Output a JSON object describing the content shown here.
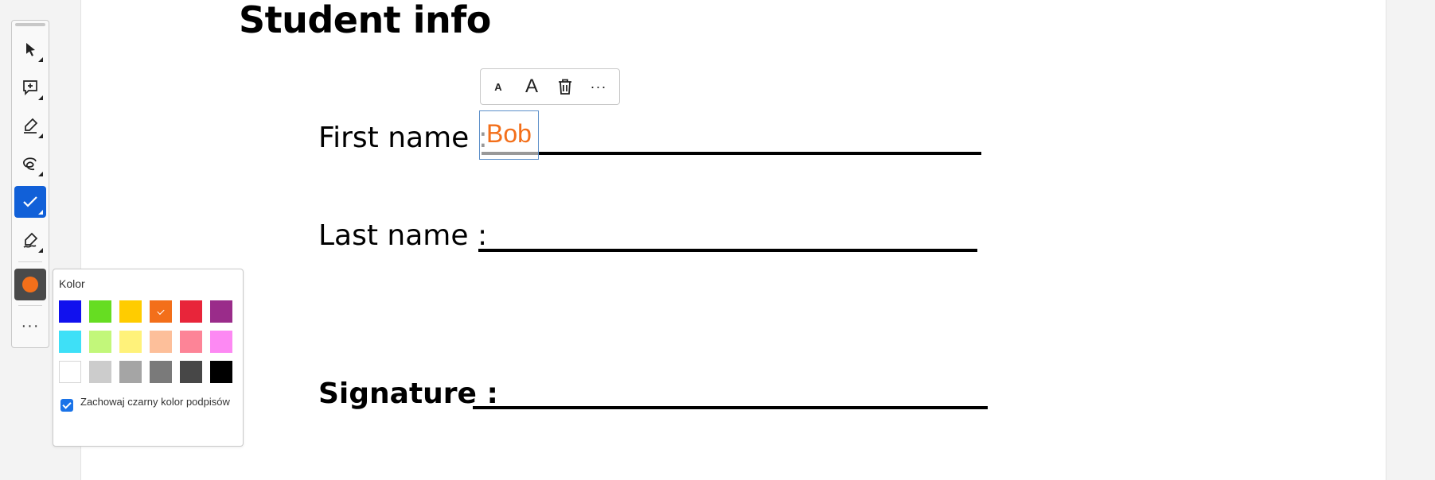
{
  "document": {
    "title": "Student info",
    "fields": [
      {
        "label": "First name :"
      },
      {
        "label": "Last name :"
      },
      {
        "label": "Signature :"
      }
    ]
  },
  "annotation": {
    "text": "Bob",
    "color": "#f36f1a"
  },
  "toolbar": {
    "tools": [
      {
        "name": "select",
        "icon": "cursor-arrow-icon"
      },
      {
        "name": "comment",
        "icon": "comment-add-icon"
      },
      {
        "name": "highlight",
        "icon": "highlighter-icon"
      },
      {
        "name": "freehand",
        "icon": "freehand-loop-icon"
      },
      {
        "name": "checkmark",
        "icon": "checkmark-icon",
        "active": true
      },
      {
        "name": "signature",
        "icon": "pen-sign-icon"
      }
    ],
    "current_color": "#f36f1a",
    "more_label": "···"
  },
  "floating_toolbar": {
    "decrease_label": "A",
    "increase_label": "A",
    "delete_icon": "trash-icon",
    "more_label": "···"
  },
  "color_picker": {
    "title": "Kolor",
    "swatches": [
      [
        "#1111ee",
        "#66dd22",
        "#ffcc00",
        "#f36f1a",
        "#e8253a",
        "#9a2c8a"
      ],
      [
        "#3ee0f7",
        "#c2f77a",
        "#fff27a",
        "#fdbf9a",
        "#fd8497",
        "#fd89f3"
      ],
      [
        "#ffffff",
        "#cccccc",
        "#a5a5a5",
        "#7a7a7a",
        "#474747",
        "#000000"
      ]
    ],
    "selected": "#f36f1a",
    "keep_black_signature": {
      "checked": true,
      "label": "Zachowaj czarny kolor podpisów"
    }
  }
}
